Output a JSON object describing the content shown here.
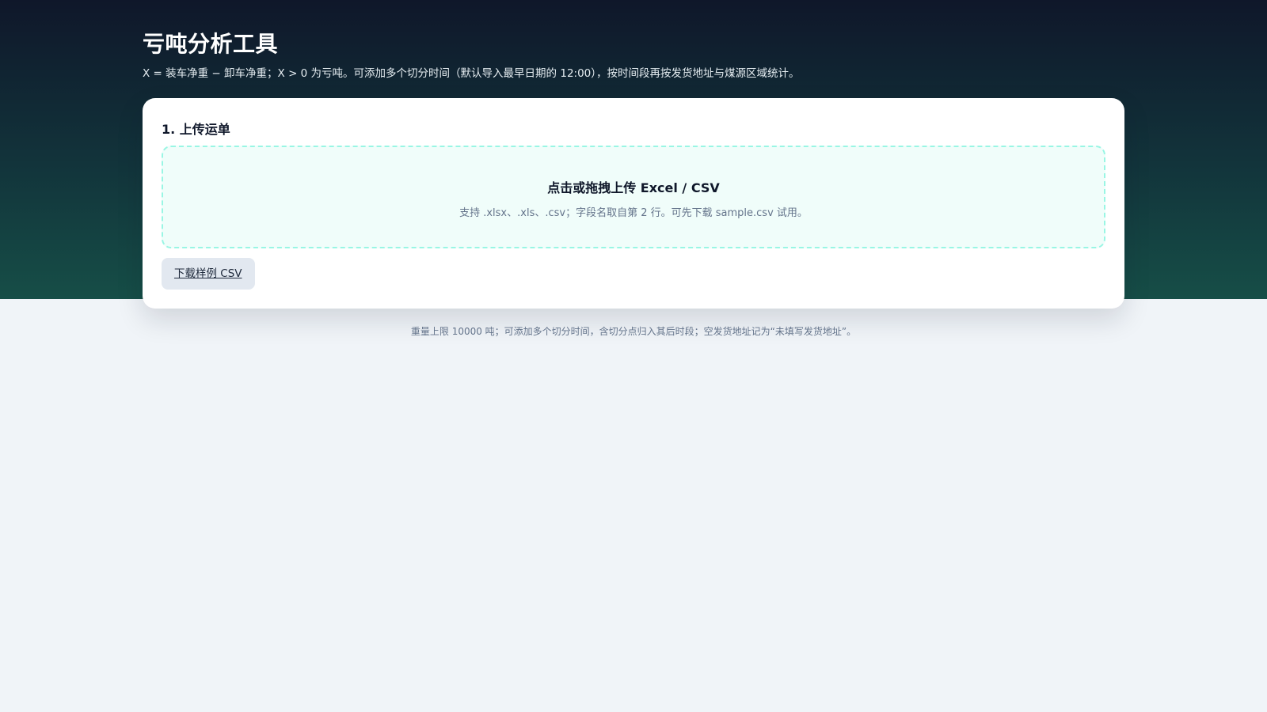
{
  "header": {
    "title": "亏吨分析工具",
    "subtitle": "X = 装车净重 − 卸车净重；X > 0 为亏吨。可添加多个切分时间（默认导入最早日期的 12:00），按时间段再按发货地址与煤源区域统计。"
  },
  "upload": {
    "section_title": "1. 上传运单",
    "dropzone_title": "点击或拖拽上传 Excel / CSV",
    "dropzone_hint": "支持 .xlsx、.xls、.csv；字段名取自第 2 行。可先下载 sample.csv 试用。",
    "sample_button_label": "下载样例 CSV"
  },
  "footer": {
    "note": "重量上限 10000 吨；可添加多个切分时间，含切分点归入其后时段；空发货地址记为“未填写发货地址”。"
  },
  "colors": {
    "hero_top": "#0f172a",
    "hero_bottom": "#164e47",
    "dropzone_border": "#99f6e4",
    "dropzone_bg": "#f0fdfa",
    "page_bg": "#f0f4f8"
  }
}
